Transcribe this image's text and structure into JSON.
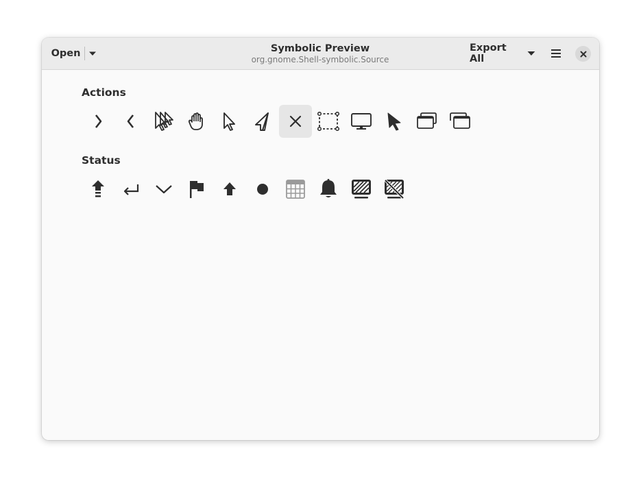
{
  "header": {
    "open_label": "Open",
    "title": "Symbolic Preview",
    "subtitle": "org.gnome.Shell-symbolic.Source",
    "export_label": "Export All"
  },
  "sections": [
    {
      "title": "Actions",
      "icons": [
        "go-next-icon",
        "go-previous-icon",
        "pointer-select-icon",
        "hand-grab-icon",
        "pointer-outline-icon",
        "pointer-drag-icon",
        "close-x-icon",
        "selection-rectangle-icon",
        "screen-icon",
        "pointer-filled-icon",
        "window-restore-icon",
        "window-stack-icon"
      ],
      "selected_index": 6
    },
    {
      "title": "Status",
      "icons": [
        "arrow-up-bar-icon",
        "enter-return-icon",
        "chevron-down-icon",
        "flag-icon",
        "arrow-up-icon",
        "dot-icon",
        "calendar-grid-icon",
        "bell-icon",
        "display-brightness-icon",
        "display-disabled-icon"
      ]
    }
  ],
  "colors": {
    "icon": "#2e2e2e",
    "headerbar": "#ebebeb",
    "background": "#fafafa",
    "selected": "#e6e6e6"
  }
}
